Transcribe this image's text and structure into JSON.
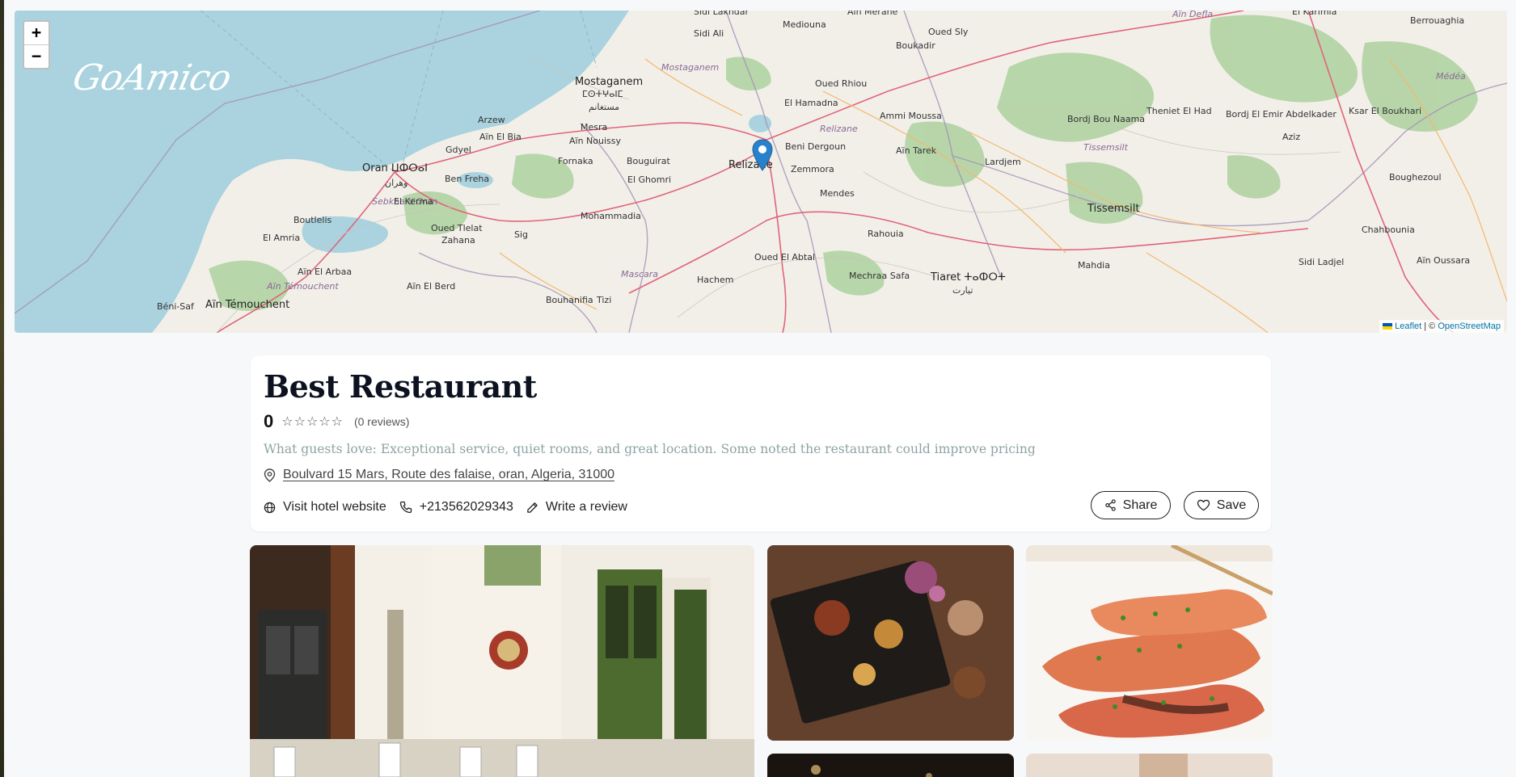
{
  "map": {
    "zoom_in": "+",
    "zoom_out": "−",
    "brand": "GoAmico",
    "attribution_leaflet": "Leaflet",
    "attribution_sep": " | © ",
    "attribution_osm": "OpenStreetMap",
    "places": {
      "oran": "Oran ⵡⵀⵔⴰⵏ",
      "oran_ar": "وهران",
      "mostaganem": "Mostaganem",
      "mostaganem_tz": "ⵎⵙⵜⵖⴰⵏⵎ",
      "mostaganem_ar": "مستغانم",
      "relizane": "Relizane",
      "relizane_reg": "Relizane",
      "mostaganem_reg": "Mostaganem",
      "tiaret": "Tiaret ⵜⴰⵀⵔⵜ",
      "tiaret_ar": "تيارت",
      "tissemsilt": "Tissemsilt",
      "tissemsilt_reg": "Tissemsilt",
      "mascara": "Mascara",
      "ain_temouchent": "Aïn Témouchent",
      "ain_temouchent_reg": "Aïn Témouchent",
      "arzew": "Arzew",
      "gdyel": "Gdyel",
      "ben_freha": "Ben Freha",
      "el_kerma": "El Kerma",
      "boutlelis": "Boutlelis",
      "el_amria": "El Amria",
      "ain_el_arbaa": "Aïn El Arbaa",
      "oued_tlelat": "Oued Tlelat",
      "zahana": "Zahana",
      "sig": "Sig",
      "ain_el_berd": "Aïn El Berd",
      "sebkha": "Sebkha d'Oran",
      "beni_saf": "Béni-Saf",
      "mohammadia": "Mohammadia",
      "fornaka": "Fornaka",
      "bouguirat": "Bouguirat",
      "el_ghomri": "El Ghomri",
      "ain_nouissy": "Aïn Nouissy",
      "mesra": "Mesra",
      "ain_el_bia": "Aïn El Bia",
      "sidi_ali": "Sidi Ali",
      "mediouna": "Mediouna",
      "oued_rhiou": "Oued Rhiou",
      "el_hamadna": "El Hamadna",
      "beni_dergoun": "Beni Dergoun",
      "zemmora": "Zemmora",
      "mendes": "Mendes",
      "rahouia": "Rahouia",
      "oued_el_abtal": "Oued El Abtal",
      "hachem": "Hachem",
      "bouhanifia": "Bouhanifia",
      "tizi": "Tizi",
      "mechraa_safa": "Mechraa Safa",
      "ammi_moussa": "Ammi Moussa",
      "ain_tarek": "Aïn Tarek",
      "bordj_bou_naama": "Bordj Bou Naama",
      "lardjem": "Lardjem",
      "theniet": "Theniet El Had",
      "bordj_el_emir": "Bordj El Emir Abdelkader",
      "aziz": "Aziz",
      "ksar": "Ksar El Boukhari",
      "berrouaghia": "Berrouaghia",
      "medea": "Médéa",
      "boughezoul": "Boughezoul",
      "chahbounia": "Chahbounia",
      "ain_oussara": "Aïn Oussara",
      "sidi_ladjel": "Sidi Ladjel",
      "mahdia": "Mahdia",
      "el_karimia": "El Karimia",
      "ain_defla": "Aïn Defla",
      "oued_sly": "Oued Sly",
      "boukadir": "Boukadir",
      "ain_merane": "Aïn Merane",
      "sidi_lakhdar": "Sidi Lakhdar"
    }
  },
  "listing": {
    "title": "Best Restaurant",
    "rating": "0",
    "stars": [
      "☆",
      "☆",
      "☆",
      "☆",
      "☆"
    ],
    "review_count": "(0 reviews)",
    "guests_love": "What guests love: Exceptional service, quiet rooms, and great location. Some noted the restaurant could improve pricing",
    "address": "Boulvard 15 Mars, Route des falaise, oran, Algeria, 31000",
    "website_label": "Visit hotel website",
    "phone": "+213562029343",
    "review_label": "Write a review",
    "share_label": "Share",
    "save_label": "Save"
  },
  "colors": {
    "sea": "#aad3df",
    "land": "#f2efe9",
    "forest": "#add19e",
    "marker": "#2a81cb"
  }
}
